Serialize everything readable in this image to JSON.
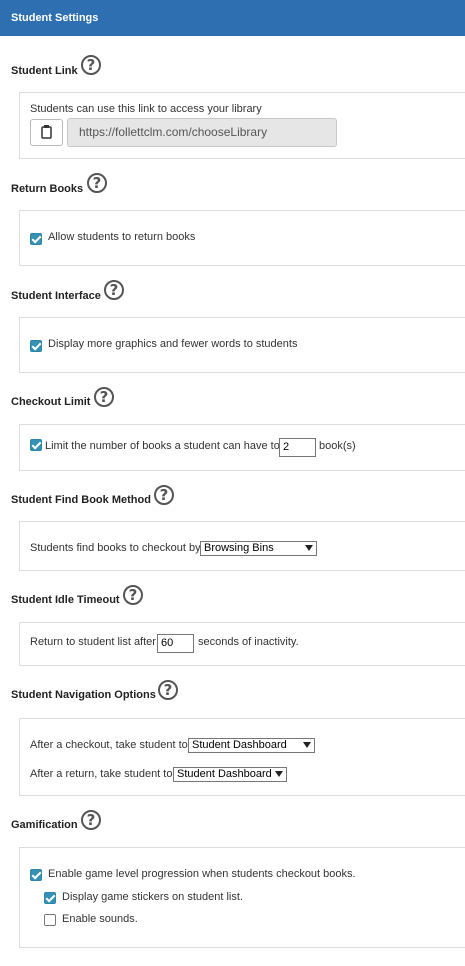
{
  "header": {
    "title": "Student Settings"
  },
  "sections": {
    "student_link": {
      "title": "Student Link",
      "description": "Students can use this link to access your library",
      "url": "https://follettclm.com/chooseLibrary"
    },
    "return_books": {
      "title": "Return Books",
      "checkbox_label": "Allow students to return books",
      "checked": true
    },
    "student_interface": {
      "title": "Student Interface",
      "checkbox_label": "Display more graphics and fewer words to students",
      "checked": true
    },
    "checkout_limit": {
      "title": "Checkout Limit",
      "label_before": "Limit the number of books a student can have to",
      "value": "2",
      "label_after": "book(s)",
      "checked": true
    },
    "find_book_method": {
      "title": "Student Find Book Method",
      "label": "Students find books to checkout by",
      "selected": "Browsing Bins"
    },
    "idle_timeout": {
      "title": "Student Idle Timeout",
      "label_before": "Return to student list after",
      "value": "60",
      "label_after": "seconds of inactivity."
    },
    "navigation": {
      "title": "Student Navigation Options",
      "after_checkout_label": "After a checkout, take student to",
      "after_checkout_value": "Student Dashboard",
      "after_return_label": "After a return, take student to",
      "after_return_value": "Student Dashboard"
    },
    "gamification": {
      "title": "Gamification",
      "level_label": "Enable game level progression when students checkout books.",
      "level_checked": true,
      "stickers_label": "Display game stickers on student list.",
      "stickers_checked": true,
      "sounds_label": "Enable sounds.",
      "sounds_checked": false
    }
  },
  "help_glyph": "?",
  "icons": {
    "help": "help-circle-icon",
    "copy": "clipboard-icon"
  }
}
